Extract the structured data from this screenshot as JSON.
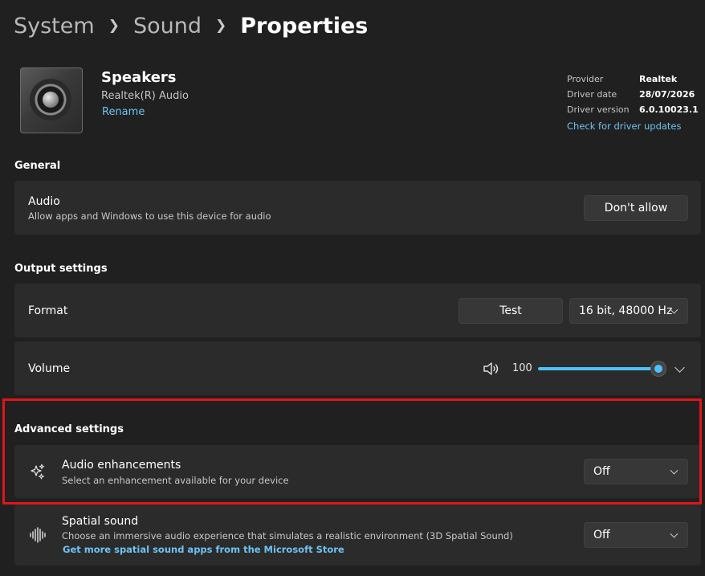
{
  "breadcrumb": {
    "level1": "System",
    "level2": "Sound",
    "current": "Properties"
  },
  "device": {
    "name": "Speakers",
    "subtitle": "Realtek(R) Audio",
    "rename_label": "Rename"
  },
  "driver": {
    "provider_label": "Provider",
    "provider_value": "Realtek",
    "date_label": "Driver date",
    "date_value": "28/07/2026",
    "version_label": "Driver version",
    "version_value": "6.0.10023.1",
    "update_link": "Check for driver updates"
  },
  "general": {
    "title": "General",
    "audio_title": "Audio",
    "audio_desc": "Allow apps and Windows to use this device for audio",
    "audio_button": "Don't allow"
  },
  "output": {
    "title": "Output settings",
    "format_label": "Format",
    "test_button": "Test",
    "format_value": "16 bit, 48000 Hz",
    "volume_label": "Volume",
    "volume_value": "100",
    "volume_level": 1.0
  },
  "advanced": {
    "title": "Advanced settings",
    "enh_title": "Audio enhancements",
    "enh_desc": "Select an enhancement available for your device",
    "enh_value": "Off",
    "spatial_title": "Spatial sound",
    "spatial_desc": "Choose an immersive audio experience that simulates a realistic environment (3D Spatial Sound)",
    "spatial_link": "Get more spatial sound apps from the Microsoft Store",
    "spatial_value": "Off"
  },
  "colors": {
    "accent": "#4cc2ff",
    "link": "#6ec3f3",
    "highlight": "#e0151b",
    "card": "#2b2b2b",
    "background": "#202020"
  },
  "icons": [
    "speaker-volume-icon",
    "sparkle-icon",
    "spatial-sound-icon",
    "chevron-down-icon"
  ]
}
